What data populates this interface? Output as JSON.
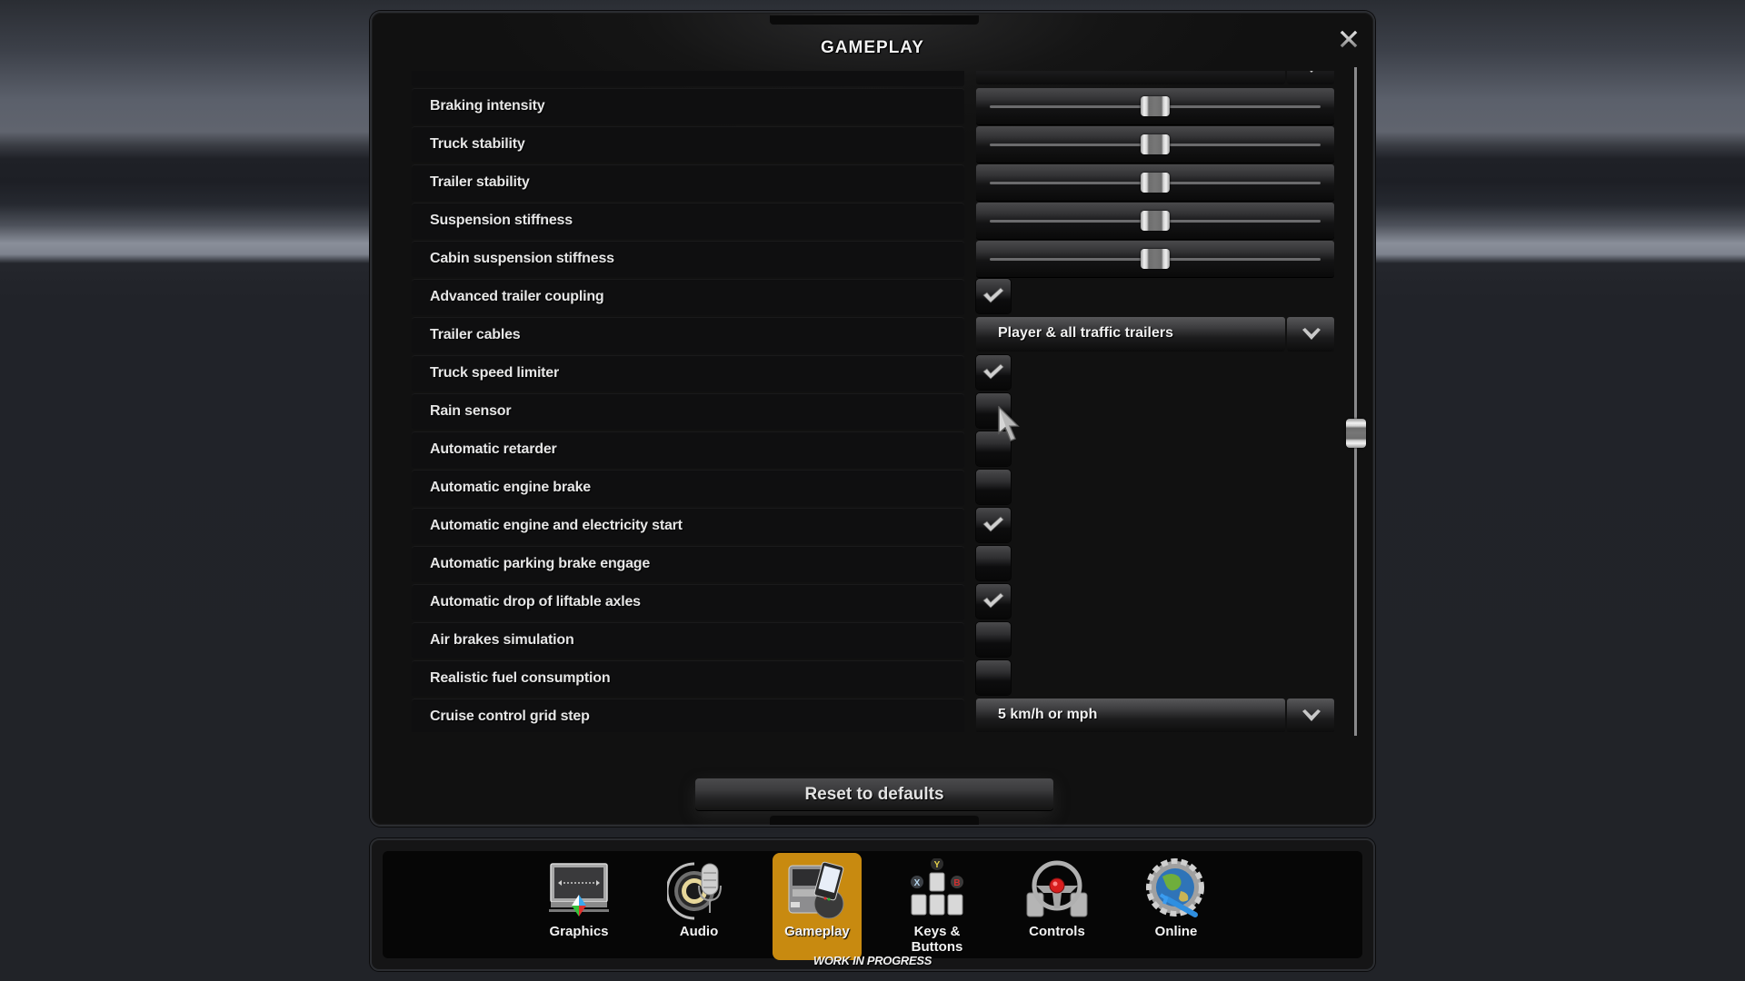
{
  "panel": {
    "title": "GAMEPLAY",
    "close_icon": "close-x-icon"
  },
  "settings": [
    {
      "label": "",
      "type": "dropdown",
      "value": "",
      "partial": true
    },
    {
      "label": "Braking intensity",
      "type": "slider",
      "value": 0.5
    },
    {
      "label": "Truck stability",
      "type": "slider",
      "value": 0.5
    },
    {
      "label": "Trailer stability",
      "type": "slider",
      "value": 0.5
    },
    {
      "label": "Suspension stiffness",
      "type": "slider",
      "value": 0.5
    },
    {
      "label": "Cabin suspension stiffness",
      "type": "slider",
      "value": 0.5
    },
    {
      "label": "Advanced trailer coupling",
      "type": "checkbox",
      "checked": true
    },
    {
      "label": "Trailer cables",
      "type": "dropdown",
      "value": "Player & all traffic trailers"
    },
    {
      "label": "Truck speed limiter",
      "type": "checkbox",
      "checked": true
    },
    {
      "label": "Rain sensor",
      "type": "checkbox",
      "checked": false
    },
    {
      "label": "Automatic retarder",
      "type": "checkbox",
      "checked": false
    },
    {
      "label": "Automatic engine brake",
      "type": "checkbox",
      "checked": false
    },
    {
      "label": "Automatic engine and electricity start",
      "type": "checkbox",
      "checked": true
    },
    {
      "label": "Automatic parking brake engage",
      "type": "checkbox",
      "checked": false
    },
    {
      "label": "Automatic drop of liftable axles",
      "type": "checkbox",
      "checked": true
    },
    {
      "label": "Air brakes simulation",
      "type": "checkbox",
      "checked": false
    },
    {
      "label": "Realistic fuel consumption",
      "type": "checkbox",
      "checked": false
    },
    {
      "label": "Cruise control grid step",
      "type": "dropdown",
      "value": "5 km/h or mph"
    },
    {
      "label": "",
      "type": "dropdown",
      "value": "",
      "partial": true
    }
  ],
  "scrollbar": {
    "position": 0.55
  },
  "reset_button": {
    "label": "Reset to defaults"
  },
  "nav": {
    "items": [
      {
        "id": "graphics",
        "label": "Graphics",
        "icon": "monitor-icon",
        "active": false
      },
      {
        "id": "audio",
        "label": "Audio",
        "icon": "speaker-microphone-icon",
        "active": false
      },
      {
        "id": "gameplay",
        "label": "Gameplay",
        "icon": "truck-tablet-icon",
        "active": true
      },
      {
        "id": "keys",
        "label": "Keys & Buttons",
        "icon": "keyboard-gamepad-icon",
        "active": false
      },
      {
        "id": "controls",
        "label": "Controls",
        "icon": "steering-wheel-icon",
        "active": false
      },
      {
        "id": "online",
        "label": "Online",
        "icon": "globe-wrench-icon",
        "active": false
      }
    ],
    "footer_note": "WORK IN PROGRESS"
  },
  "colors": {
    "active_tab": "#c88a10",
    "text": "#e6e6e6"
  }
}
